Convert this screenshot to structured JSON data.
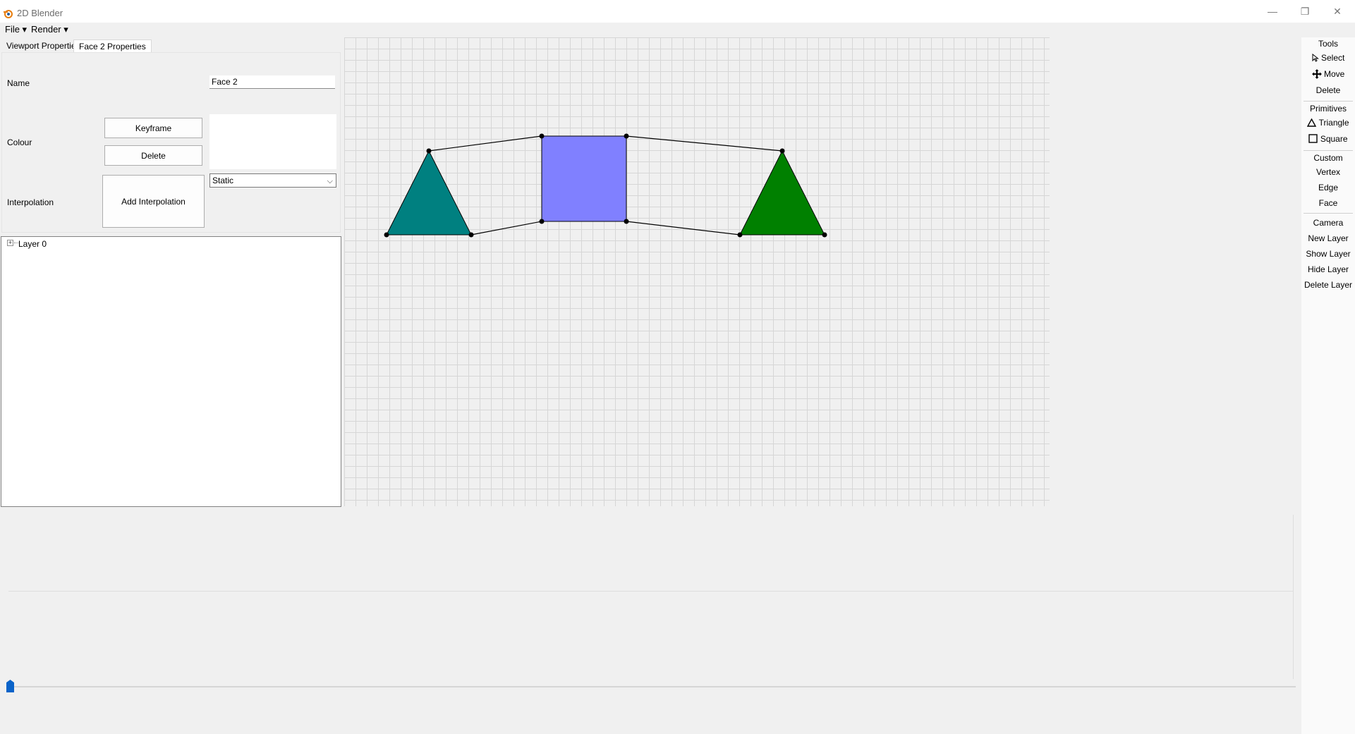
{
  "window": {
    "title": "2D Blender",
    "minimize": "—",
    "maximize": "❐",
    "close": "✕"
  },
  "menu": [
    {
      "label": "File ▾"
    },
    {
      "label": "Render ▾"
    }
  ],
  "tabs": [
    {
      "label": "Viewport Properties"
    },
    {
      "label": "Face 2 Properties",
      "active": true
    }
  ],
  "properties": {
    "name_label": "Name",
    "name_value": "Face 2",
    "colour_label": "Colour",
    "keyframe_button": "Keyframe",
    "delete_button": "Delete",
    "interpolation_label": "Interpolation",
    "add_interpolation_button": "Add Interpolation",
    "interpolation_mode": "Static",
    "colour_value": "#ffffff"
  },
  "layers": {
    "expander": "⊞",
    "items": [
      {
        "label": "Layer 0"
      }
    ]
  },
  "scene": {
    "shapes": [
      {
        "type": "triangle",
        "fill": "#008080"
      },
      {
        "type": "square",
        "fill": "#8080ff"
      },
      {
        "type": "triangle",
        "fill": "#008000"
      }
    ]
  },
  "tools": {
    "header": "Tools",
    "select": "Select",
    "move": "Move",
    "delete": "Delete",
    "primitives_header": "Primitives",
    "triangle": "Triangle",
    "square": "Square",
    "custom_header": "Custom",
    "vertex": "Vertex",
    "edge": "Edge",
    "face": "Face",
    "camera": "Camera",
    "new_layer": "New Layer",
    "show_layer": "Show Layer",
    "hide_layer": "Hide Layer",
    "delete_layer": "Delete Layer"
  },
  "timeline": {
    "current_frame": 0
  },
  "colors": {
    "accent": "#0a63c9",
    "app_icon": "#e87d0d"
  }
}
